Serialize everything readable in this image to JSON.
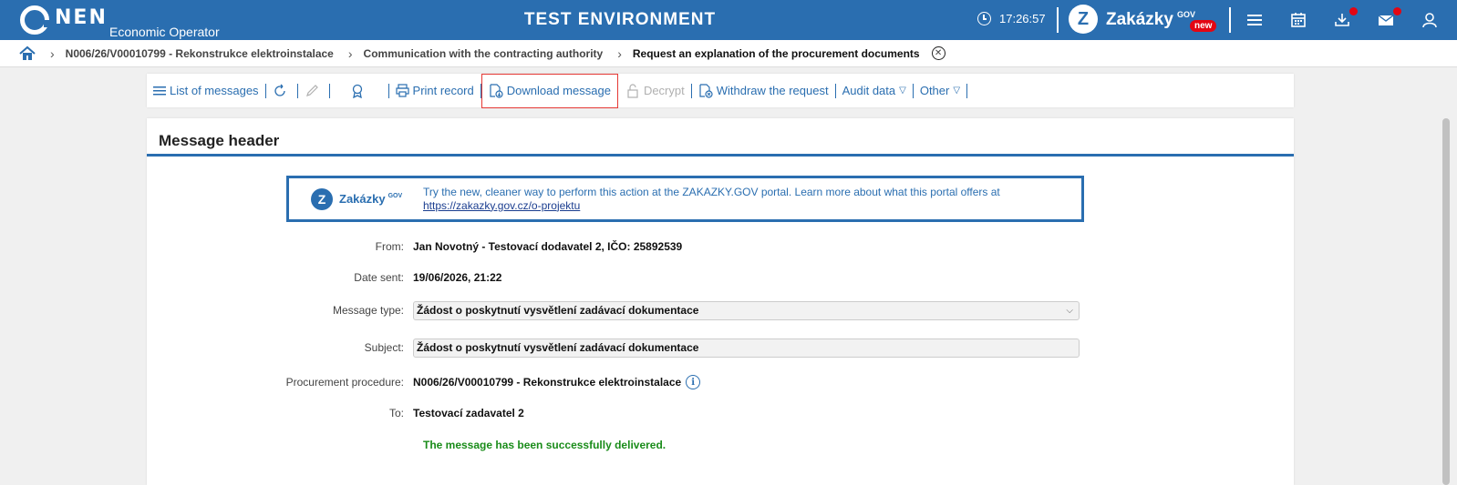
{
  "header": {
    "logo_text": "NEN",
    "logo_subtitle": "Economic Operator",
    "env_title": "TEST ENVIRONMENT",
    "time": "17:26:57",
    "portal_name": "Zakázky",
    "portal_sup": "GOV",
    "portal_badge": "new",
    "portal_logo_glyph": "Z"
  },
  "breadcrumb": {
    "items": [
      "N006/26/V00010799 - Rekonstrukce elektroinstalace",
      "Communication with the contracting authority"
    ],
    "current": "Request an explanation of the procurement documents"
  },
  "toolbar": {
    "list_label": "List of messages",
    "print_label": "Print record",
    "download_label": "Download message",
    "decrypt_label": "Decrypt",
    "withdraw_label": "Withdraw the request",
    "audit_label": "Audit data",
    "other_label": "Other"
  },
  "panel": {
    "title": "Message header",
    "promo": {
      "name": "Zakázky",
      "sup": "GOV",
      "glyph": "Z",
      "text": "Try the new, cleaner way to perform this action at the ZAKAZKY.GOV portal. Learn more about what this portal offers at",
      "link": "https://zakazky.gov.cz/o-projektu"
    },
    "fields": {
      "from_label": "From:",
      "from_value": "Jan Novotný - Testovací dodavatel 2, IČO: 25892539",
      "date_label": "Date sent:",
      "date_value": "19/06/2026, 21:22",
      "type_label": "Message type:",
      "type_value": "Žádost o poskytnutí vysvětlení zadávací dokumentace",
      "subject_label": "Subject:",
      "subject_value": "Žádost o poskytnutí vysvětlení zadávací dokumentace",
      "procedure_label": "Procurement procedure:",
      "procedure_value": "N006/26/V00010799 - Rekonstrukce elektroinstalace",
      "to_label": "To:",
      "to_value": "Testovací zadavatel 2"
    },
    "status": "The message has been successfully delivered."
  },
  "colors": {
    "brand": "#2a6eb0",
    "alert": "#e30613",
    "success": "#1a8c1a",
    "highlight": "#e53935"
  }
}
